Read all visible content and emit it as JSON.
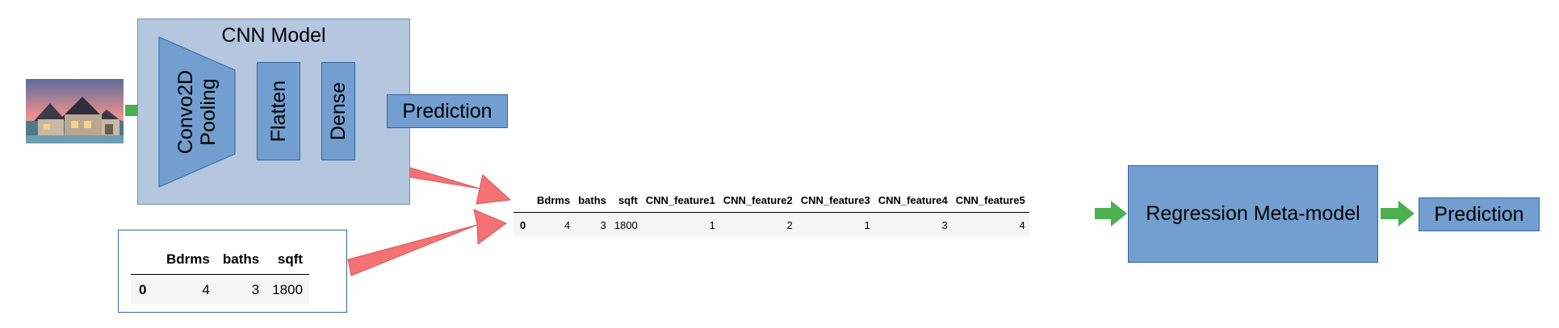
{
  "cnn_model": {
    "title": "CNN Model",
    "layers": [
      "Convo2D\nPooling",
      "Flatten",
      "Dense"
    ],
    "output_label": "Prediction"
  },
  "input_image": {
    "icon": "house-photo"
  },
  "tabular_input": {
    "columns": [
      "",
      "Bdrms",
      "baths",
      "sqft"
    ],
    "rows": [
      {
        "index": "0",
        "values": [
          "4",
          "3",
          "1800"
        ]
      }
    ]
  },
  "combined_table": {
    "columns": [
      "",
      "Bdrms",
      "baths",
      "sqft",
      "CNN_feature1",
      "CNN_feature2",
      "CNN_feature3",
      "CNN_feature4",
      "CNN_feature5"
    ],
    "rows": [
      {
        "index": "0",
        "values": [
          "4",
          "3",
          "1800",
          "1",
          "2",
          "1",
          "3",
          "4"
        ]
      }
    ]
  },
  "meta_model": {
    "label": "Regression Meta-model",
    "output_label": "Prediction"
  },
  "colors": {
    "panel": "#b4c7df",
    "box": "#729fcf",
    "box_border": "#3465a4",
    "green_arrow": "#4caf50",
    "red_arrow": "#f47174"
  }
}
